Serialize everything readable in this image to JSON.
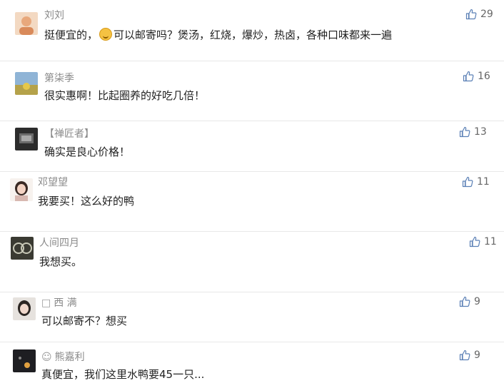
{
  "comments": [
    {
      "name": "刘刘",
      "text_before": "挺便宜的，",
      "text_after": "可以邮寄吗？煲汤，红烧，爆炒，热卤，各种口味都来一遍",
      "likes": "29"
    },
    {
      "name": "第柒季",
      "text": "很实惠啊！比起圈养的好吃几倍！",
      "likes": "16"
    },
    {
      "name": "【禅匠者】",
      "text": "确实是良心价格！",
      "likes": "13"
    },
    {
      "name": "邓望望",
      "text": "我要买！这么好的鸭",
      "likes": "11"
    },
    {
      "name": "人间四月",
      "text": "我想买。",
      "likes": "11"
    },
    {
      "name_prefix": "□",
      "name": "西 满",
      "text": "可以邮寄不？想买",
      "likes": "9"
    },
    {
      "name_prefix": "☺",
      "name": "熊嘉利",
      "text": "真便宜，我们这里水鸭要45一只...",
      "likes": "9"
    }
  ],
  "icons": {
    "like": "thumbs-up-icon",
    "emoji": "grinning-emoji-icon"
  },
  "colors": {
    "name": "#8a8a8a",
    "text": "#222222",
    "like": "#5a7fb5"
  }
}
